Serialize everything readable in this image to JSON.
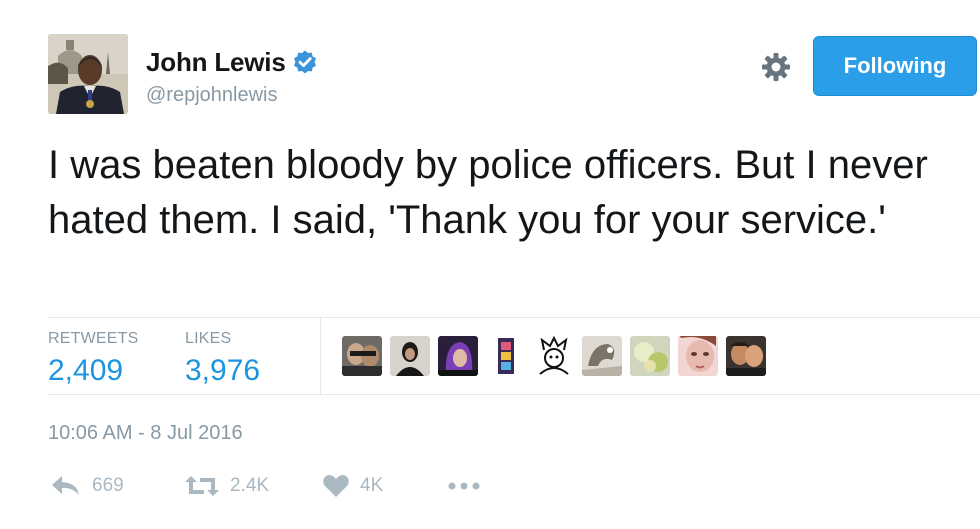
{
  "user": {
    "display_name": "John Lewis",
    "handle": "@repjohnlewis",
    "verified_icon": "verified-badge-icon"
  },
  "header": {
    "settings_icon": "gear-icon",
    "follow_label": "Following"
  },
  "tweet": {
    "text": "I was beaten bloody by police officers. But I never hated them. I said, 'Thank you for your service.'",
    "timestamp": "10:06 AM - 8 Jul 2016"
  },
  "stats": {
    "retweets_label": "RETWEETS",
    "retweets_value": "2,409",
    "likes_label": "LIKES",
    "likes_value": "3,976"
  },
  "actions": {
    "reply_count": "669",
    "retweet_count": "2.4K",
    "like_count": "4K",
    "more_icon": "more-dots-icon"
  },
  "colors": {
    "accent": "#1b95e0",
    "button": "#2b9ee9",
    "muted": "#8899a6",
    "action_muted": "#aab8c2"
  }
}
